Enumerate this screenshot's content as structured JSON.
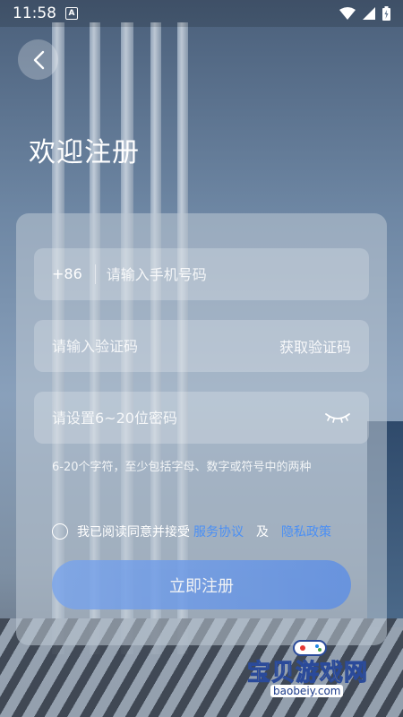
{
  "status_bar": {
    "time": "11:58",
    "badge": "A"
  },
  "header": {
    "title": "欢迎注册"
  },
  "form": {
    "phone_prefix": "+86",
    "phone_placeholder": "请输入手机号码",
    "code_placeholder": "请输入验证码",
    "get_code_label": "获取验证码",
    "password_placeholder": "请设置6~20位密码",
    "password_hint": "6-20个字符，至少包括字母、数字或符号中的两种"
  },
  "agreement": {
    "prefix": "我已阅读同意并接受",
    "service_link": "服务协议",
    "and": "及",
    "privacy_link": "隐私政策"
  },
  "submit_label": "立即注册",
  "watermark": {
    "text": "宝贝游戏网",
    "sub": "baobeiy.com"
  },
  "colors": {
    "link": "#4a8ff5",
    "button": "#6a98e6"
  }
}
